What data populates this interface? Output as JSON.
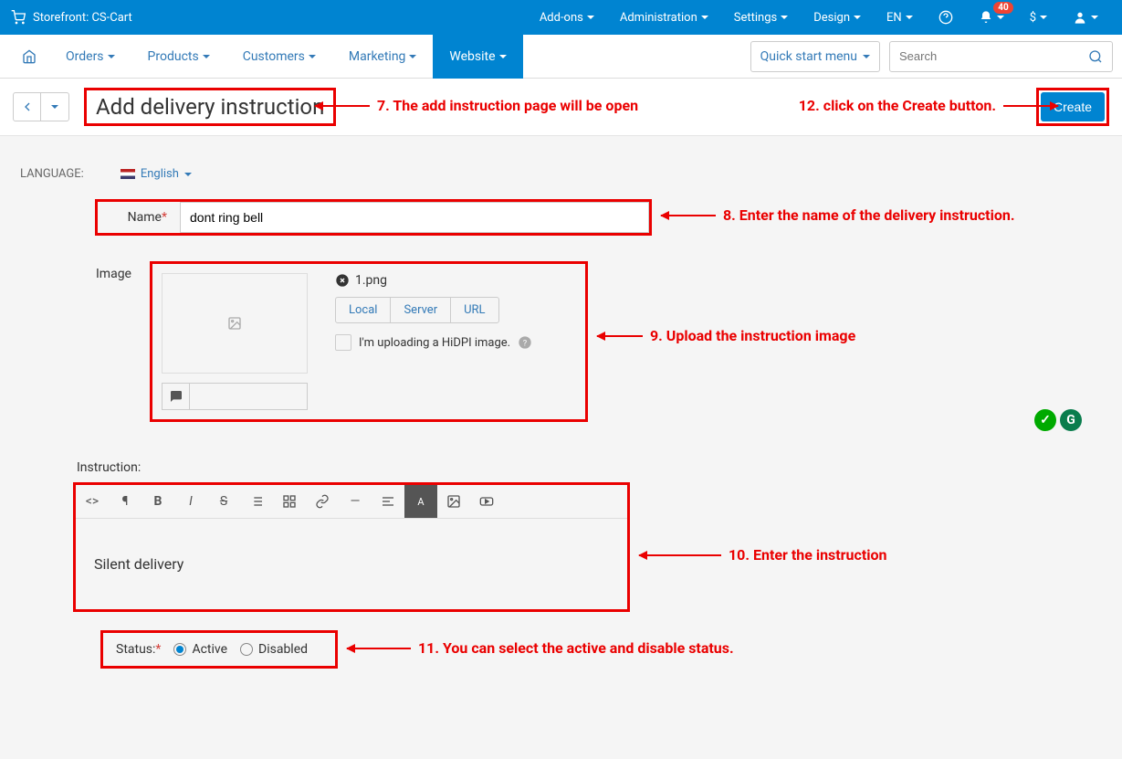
{
  "topbar": {
    "storefront_label": "Storefront: CS-Cart",
    "menus": [
      "Add-ons",
      "Administration",
      "Settings",
      "Design",
      "EN"
    ],
    "notif_count": "40",
    "currency": "$"
  },
  "subnav": {
    "items": [
      "Orders",
      "Products",
      "Customers",
      "Marketing",
      "Website"
    ],
    "active_index": 4,
    "quick_start": "Quick start menu",
    "search_placeholder": "Search"
  },
  "title": "Add delivery instruction",
  "create_label": "Create",
  "language": {
    "label": "LANGUAGE:",
    "value": "English"
  },
  "form": {
    "name_label": "Name",
    "name_value": "dont ring bell",
    "image_label": "Image",
    "filename": "1.png",
    "upload_tabs": [
      "Local",
      "Server",
      "URL"
    ],
    "hidpi_label": "I'm uploading a HiDPI image.",
    "instruction_label": "Instruction:",
    "instruction_value": "Silent delivery",
    "status_label": "Status:",
    "status_options": [
      "Active",
      "Disabled"
    ]
  },
  "annotations": {
    "a7": "7. The add instruction page will be open",
    "a8": "8. Enter the name of the delivery instruction.",
    "a9": "9. Upload the instruction image",
    "a10": "10. Enter the instruction",
    "a11": "11. You can select the active and disable status.",
    "a12": "12. click on the Create button."
  }
}
